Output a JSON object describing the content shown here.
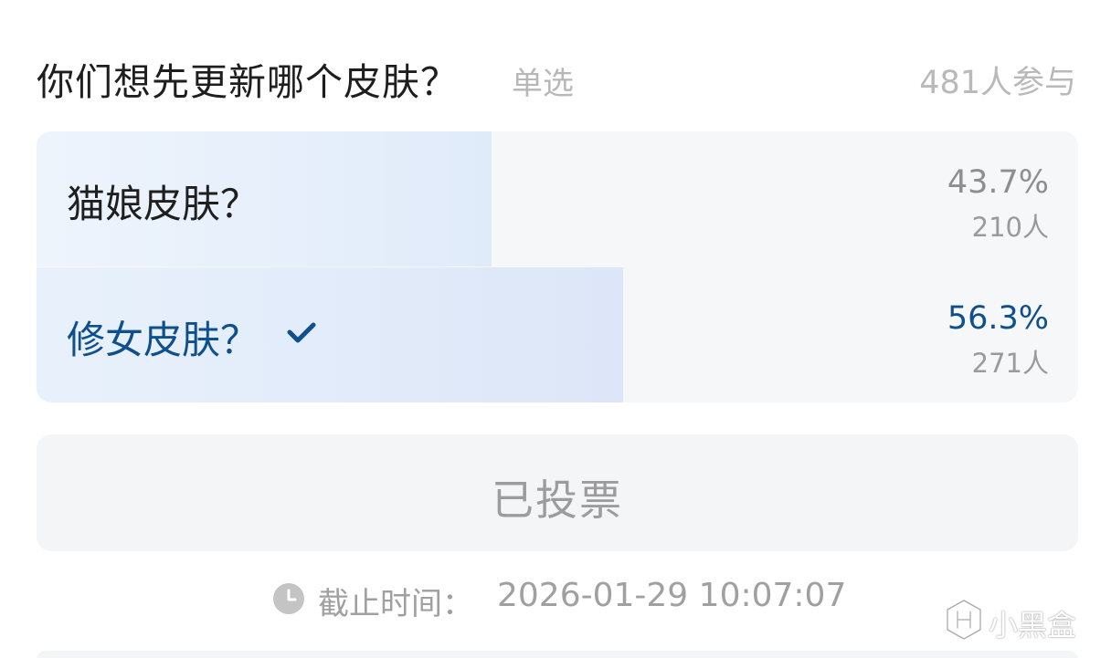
{
  "poll": {
    "title": "你们想先更新哪个皮肤？",
    "type_label": "单选",
    "participants": "481人参与",
    "options": [
      {
        "label": "猫娘皮肤？",
        "percent": "43.7%",
        "count": "210人",
        "fill_fraction": 0.437,
        "selected": false
      },
      {
        "label": "修女皮肤？",
        "percent": "56.3%",
        "count": "271人",
        "fill_fraction": 0.563,
        "selected": true,
        "check_icon": "check-icon"
      }
    ],
    "vote_button": {
      "label": "已投票",
      "state": "disabled"
    },
    "deadline": {
      "icon": "clock-icon",
      "label": "截止时间：",
      "value": "2026-01-29 10:07:07"
    }
  },
  "watermark": {
    "logo_icon": "heybox-logo-icon",
    "text": "小黑盒"
  },
  "colors": {
    "title_text": "#1e1e1e",
    "muted_text": "#b7b7b7",
    "selected_accent": "#0f4f8c",
    "option_background": "#f6f7f9",
    "fill_light_blue": "#e0ebfa",
    "button_background": "#f4f5f7"
  }
}
